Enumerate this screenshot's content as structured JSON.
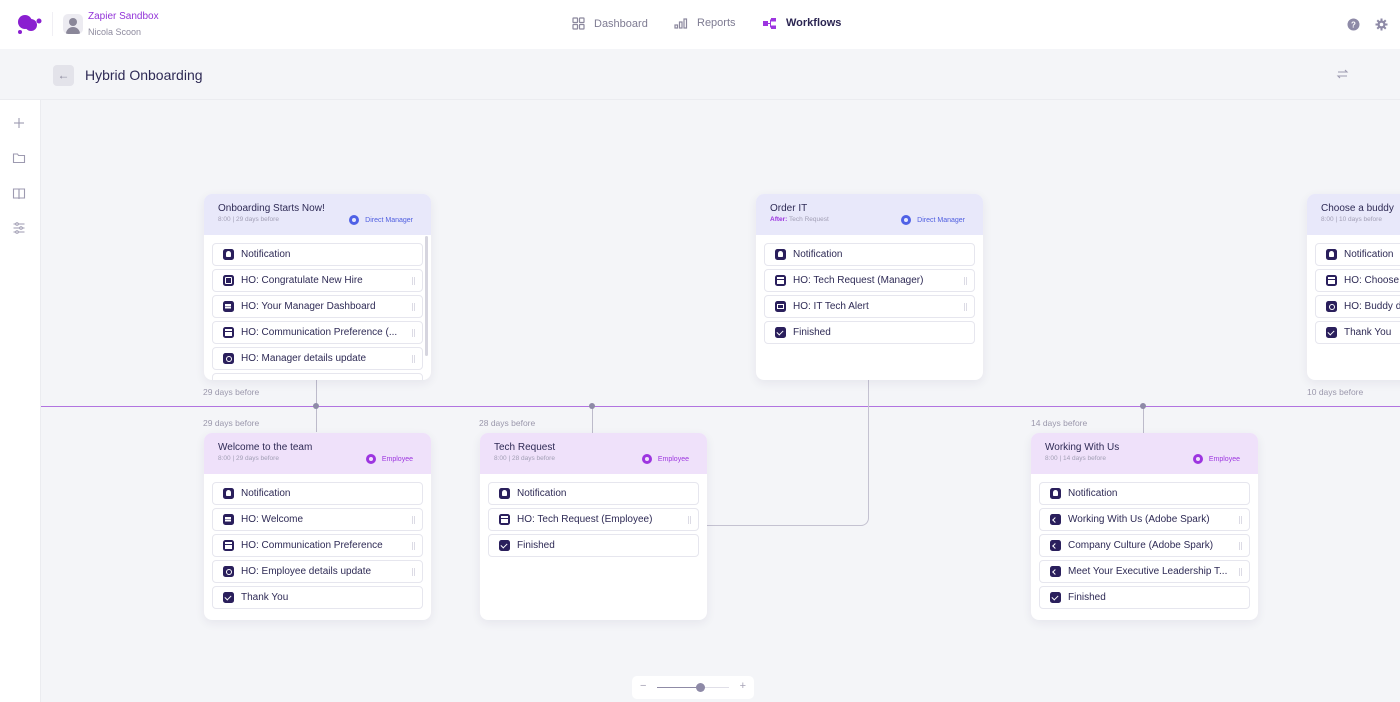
{
  "topbar": {
    "org_name": "Zapier Sandbox",
    "user_name": "Nicola Scoon",
    "nav": [
      {
        "label": "Dashboard",
        "icon": "grid-icon",
        "active": false
      },
      {
        "label": "Reports",
        "icon": "bar-chart-icon",
        "active": false
      },
      {
        "label": "Workflows",
        "icon": "workflow-icon",
        "active": true
      }
    ],
    "right_icons": [
      "help-icon",
      "gear-icon"
    ]
  },
  "header": {
    "title": "Hybrid Onboarding",
    "back_icon": "arrow-left-icon",
    "right_icon": "swap-icon"
  },
  "sidebar": {
    "icons": [
      "plus-icon",
      "folder-icon",
      "book-icon",
      "sliders-icon"
    ]
  },
  "colors": {
    "accent": "#9d35e0",
    "manager": "#4f61e6",
    "manager_bg": "#e8e8fa",
    "employee_bg": "#efe1fa",
    "timeline": "#b174e0",
    "icon_dark": "#2a1f5c"
  },
  "cards": [
    {
      "title": "Onboarding Starts Now!",
      "subtitle": "8:00 | 29 days before",
      "role": "Direct Manager",
      "above_label": "",
      "below_label": "29 days before",
      "items": [
        {
          "label": "Notification",
          "icon": "bell"
        },
        {
          "label": "HO: Congratulate New Hire",
          "icon": "chat"
        },
        {
          "label": "HO: Your Manager Dashboard",
          "icon": "doc"
        },
        {
          "label": "HO: Communication Preference (...",
          "icon": "form"
        },
        {
          "label": "HO: Manager details update",
          "icon": "sync"
        }
      ]
    },
    {
      "title": "Welcome to the team",
      "subtitle": "8:00 | 29 days before",
      "role": "Employee",
      "above_label": "29 days before",
      "items": [
        {
          "label": "Notification",
          "icon": "bell"
        },
        {
          "label": "HO: Welcome",
          "icon": "doc"
        },
        {
          "label": "HO: Communication Preference",
          "icon": "form"
        },
        {
          "label": "HO: Employee details update",
          "icon": "sync"
        },
        {
          "label": "Thank You",
          "icon": "check"
        }
      ]
    },
    {
      "title": "Tech Request",
      "subtitle": "8:00 | 28 days before",
      "role": "Employee",
      "above_label": "28 days before",
      "items": [
        {
          "label": "Notification",
          "icon": "bell"
        },
        {
          "label": "HO: Tech Request (Employee)",
          "icon": "form"
        },
        {
          "label": "Finished",
          "icon": "check"
        }
      ]
    },
    {
      "title": "Order IT",
      "subtitle_prefix": "After:",
      "subtitle": "Tech Request",
      "role": "Direct Manager",
      "items": [
        {
          "label": "Notification",
          "icon": "bell"
        },
        {
          "label": "HO: Tech Request (Manager)",
          "icon": "form"
        },
        {
          "label": "HO: IT Tech Alert",
          "icon": "mail"
        },
        {
          "label": "Finished",
          "icon": "check"
        }
      ]
    },
    {
      "title": "Working With Us",
      "subtitle": "8:00 | 14 days before",
      "role": "Employee",
      "above_label": "14 days before",
      "items": [
        {
          "label": "Notification",
          "icon": "bell"
        },
        {
          "label": "Working With Us (Adobe Spark)",
          "icon": "code"
        },
        {
          "label": "Company Culture (Adobe Spark)",
          "icon": "code"
        },
        {
          "label": "Meet Your Executive Leadership T...",
          "icon": "code"
        },
        {
          "label": "Finished",
          "icon": "check"
        }
      ]
    },
    {
      "title": "Choose a buddy",
      "subtitle": "8:00 | 10 days before",
      "role": "",
      "below_label": "10 days before",
      "items": [
        {
          "label": "Notification",
          "icon": "bell"
        },
        {
          "label": "HO: Choose",
          "icon": "form"
        },
        {
          "label": "HO: Buddy d",
          "icon": "sync"
        },
        {
          "label": "Thank You",
          "icon": "check"
        }
      ]
    }
  ],
  "zoom": {
    "minus_label": "−",
    "plus_label": "+",
    "level": 0.6
  }
}
